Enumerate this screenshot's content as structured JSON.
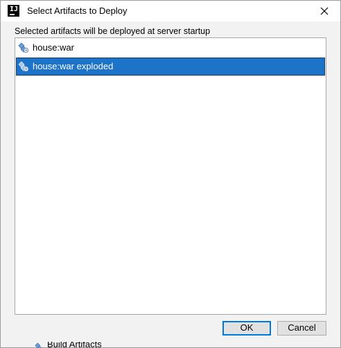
{
  "window": {
    "title": "Select Artifacts to Deploy",
    "app_icon": "intellij-idea-icon",
    "app_icon_glyph": "IJ",
    "close_icon": "close-icon"
  },
  "caption": "Selected artifacts will be deployed at server startup",
  "artifacts": [
    {
      "label": "house:war",
      "icon": "artifact-icon",
      "selected": false
    },
    {
      "label": "house:war exploded",
      "icon": "artifact-icon",
      "selected": true
    }
  ],
  "buttons": {
    "ok": "OK",
    "cancel": "Cancel"
  },
  "background": {
    "partial_label": "Build Artifacts"
  },
  "colors": {
    "selection": "#1d73c8",
    "default_button_border": "#0078d7",
    "artifact_icon_blue": "#4f86c6"
  }
}
